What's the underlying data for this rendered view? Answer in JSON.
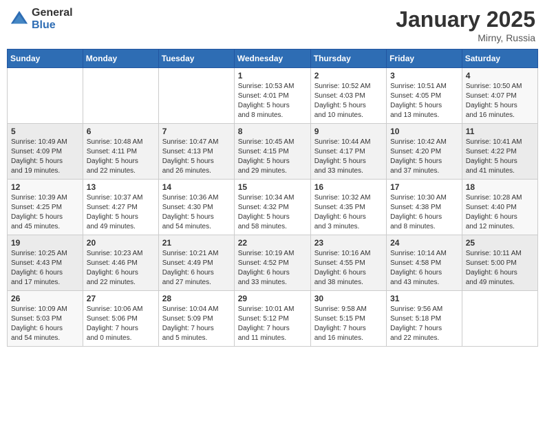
{
  "header": {
    "logo_general": "General",
    "logo_blue": "Blue",
    "month_year": "January 2025",
    "location": "Mirny, Russia"
  },
  "weekdays": [
    "Sunday",
    "Monday",
    "Tuesday",
    "Wednesday",
    "Thursday",
    "Friday",
    "Saturday"
  ],
  "weeks": [
    [
      {
        "day": "",
        "info": ""
      },
      {
        "day": "",
        "info": ""
      },
      {
        "day": "",
        "info": ""
      },
      {
        "day": "1",
        "info": "Sunrise: 10:53 AM\nSunset: 4:01 PM\nDaylight: 5 hours\nand 8 minutes."
      },
      {
        "day": "2",
        "info": "Sunrise: 10:52 AM\nSunset: 4:03 PM\nDaylight: 5 hours\nand 10 minutes."
      },
      {
        "day": "3",
        "info": "Sunrise: 10:51 AM\nSunset: 4:05 PM\nDaylight: 5 hours\nand 13 minutes."
      },
      {
        "day": "4",
        "info": "Sunrise: 10:50 AM\nSunset: 4:07 PM\nDaylight: 5 hours\nand 16 minutes."
      }
    ],
    [
      {
        "day": "5",
        "info": "Sunrise: 10:49 AM\nSunset: 4:09 PM\nDaylight: 5 hours\nand 19 minutes."
      },
      {
        "day": "6",
        "info": "Sunrise: 10:48 AM\nSunset: 4:11 PM\nDaylight: 5 hours\nand 22 minutes."
      },
      {
        "day": "7",
        "info": "Sunrise: 10:47 AM\nSunset: 4:13 PM\nDaylight: 5 hours\nand 26 minutes."
      },
      {
        "day": "8",
        "info": "Sunrise: 10:45 AM\nSunset: 4:15 PM\nDaylight: 5 hours\nand 29 minutes."
      },
      {
        "day": "9",
        "info": "Sunrise: 10:44 AM\nSunset: 4:17 PM\nDaylight: 5 hours\nand 33 minutes."
      },
      {
        "day": "10",
        "info": "Sunrise: 10:42 AM\nSunset: 4:20 PM\nDaylight: 5 hours\nand 37 minutes."
      },
      {
        "day": "11",
        "info": "Sunrise: 10:41 AM\nSunset: 4:22 PM\nDaylight: 5 hours\nand 41 minutes."
      }
    ],
    [
      {
        "day": "12",
        "info": "Sunrise: 10:39 AM\nSunset: 4:25 PM\nDaylight: 5 hours\nand 45 minutes."
      },
      {
        "day": "13",
        "info": "Sunrise: 10:37 AM\nSunset: 4:27 PM\nDaylight: 5 hours\nand 49 minutes."
      },
      {
        "day": "14",
        "info": "Sunrise: 10:36 AM\nSunset: 4:30 PM\nDaylight: 5 hours\nand 54 minutes."
      },
      {
        "day": "15",
        "info": "Sunrise: 10:34 AM\nSunset: 4:32 PM\nDaylight: 5 hours\nand 58 minutes."
      },
      {
        "day": "16",
        "info": "Sunrise: 10:32 AM\nSunset: 4:35 PM\nDaylight: 6 hours\nand 3 minutes."
      },
      {
        "day": "17",
        "info": "Sunrise: 10:30 AM\nSunset: 4:38 PM\nDaylight: 6 hours\nand 8 minutes."
      },
      {
        "day": "18",
        "info": "Sunrise: 10:28 AM\nSunset: 4:40 PM\nDaylight: 6 hours\nand 12 minutes."
      }
    ],
    [
      {
        "day": "19",
        "info": "Sunrise: 10:25 AM\nSunset: 4:43 PM\nDaylight: 6 hours\nand 17 minutes."
      },
      {
        "day": "20",
        "info": "Sunrise: 10:23 AM\nSunset: 4:46 PM\nDaylight: 6 hours\nand 22 minutes."
      },
      {
        "day": "21",
        "info": "Sunrise: 10:21 AM\nSunset: 4:49 PM\nDaylight: 6 hours\nand 27 minutes."
      },
      {
        "day": "22",
        "info": "Sunrise: 10:19 AM\nSunset: 4:52 PM\nDaylight: 6 hours\nand 33 minutes."
      },
      {
        "day": "23",
        "info": "Sunrise: 10:16 AM\nSunset: 4:55 PM\nDaylight: 6 hours\nand 38 minutes."
      },
      {
        "day": "24",
        "info": "Sunrise: 10:14 AM\nSunset: 4:58 PM\nDaylight: 6 hours\nand 43 minutes."
      },
      {
        "day": "25",
        "info": "Sunrise: 10:11 AM\nSunset: 5:00 PM\nDaylight: 6 hours\nand 49 minutes."
      }
    ],
    [
      {
        "day": "26",
        "info": "Sunrise: 10:09 AM\nSunset: 5:03 PM\nDaylight: 6 hours\nand 54 minutes."
      },
      {
        "day": "27",
        "info": "Sunrise: 10:06 AM\nSunset: 5:06 PM\nDaylight: 7 hours\nand 0 minutes."
      },
      {
        "day": "28",
        "info": "Sunrise: 10:04 AM\nSunset: 5:09 PM\nDaylight: 7 hours\nand 5 minutes."
      },
      {
        "day": "29",
        "info": "Sunrise: 10:01 AM\nSunset: 5:12 PM\nDaylight: 7 hours\nand 11 minutes."
      },
      {
        "day": "30",
        "info": "Sunrise: 9:58 AM\nSunset: 5:15 PM\nDaylight: 7 hours\nand 16 minutes."
      },
      {
        "day": "31",
        "info": "Sunrise: 9:56 AM\nSunset: 5:18 PM\nDaylight: 7 hours\nand 22 minutes."
      },
      {
        "day": "",
        "info": ""
      }
    ]
  ]
}
